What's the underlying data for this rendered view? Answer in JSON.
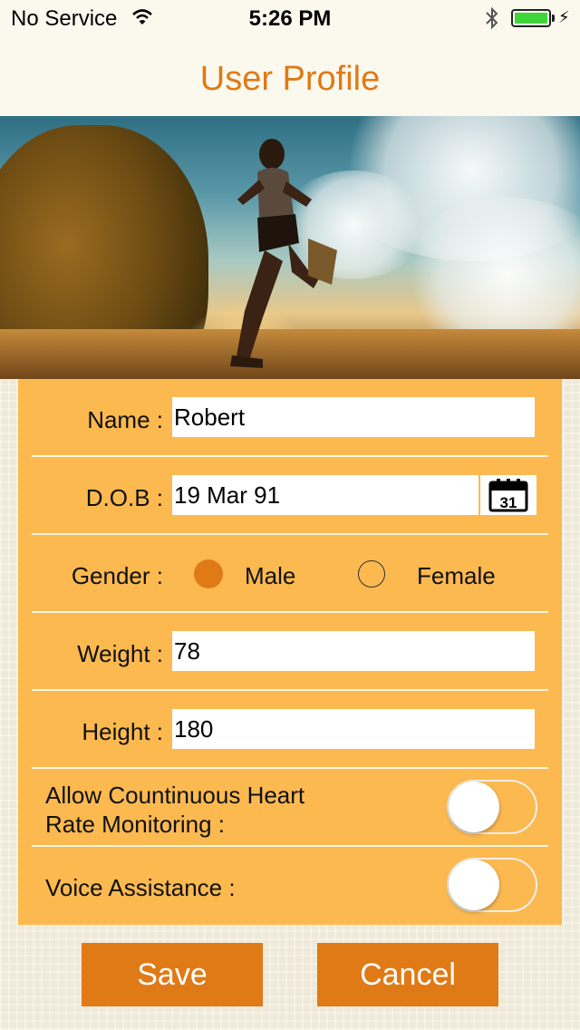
{
  "status_bar": {
    "carrier": "No Service",
    "time": "5:26 PM",
    "wifi_icon": "wifi-icon",
    "bluetooth_icon": "bluetooth-icon",
    "battery_level": 1.0,
    "battery_color": "#3fd53b"
  },
  "header": {
    "title": "User Profile"
  },
  "hero": {
    "image": "runner-at-sunset-photo"
  },
  "form": {
    "name": {
      "label": "Name :",
      "value": "Robert"
    },
    "dob": {
      "label": "D.O.B :",
      "value": "19 Mar 91",
      "calendar_day": "31",
      "calendar_icon": "calendar-icon"
    },
    "gender": {
      "label": "Gender :",
      "options": [
        "Male",
        "Female"
      ],
      "selected": "Male"
    },
    "weight": {
      "label": "Weight :",
      "value": "78"
    },
    "height": {
      "label": "Height :",
      "value": "180"
    },
    "heart_rate": {
      "label_line1": "Allow Countinuous Heart",
      "label_line2": "Rate Monitoring :",
      "enabled": false
    },
    "voice": {
      "label": "Voice Assistance :",
      "enabled": false
    }
  },
  "actions": {
    "save_label": "Save",
    "cancel_label": "Cancel"
  },
  "colors": {
    "accent": "#e07a16",
    "panel": "#fbb950",
    "header_bg": "#fbf8ee"
  }
}
